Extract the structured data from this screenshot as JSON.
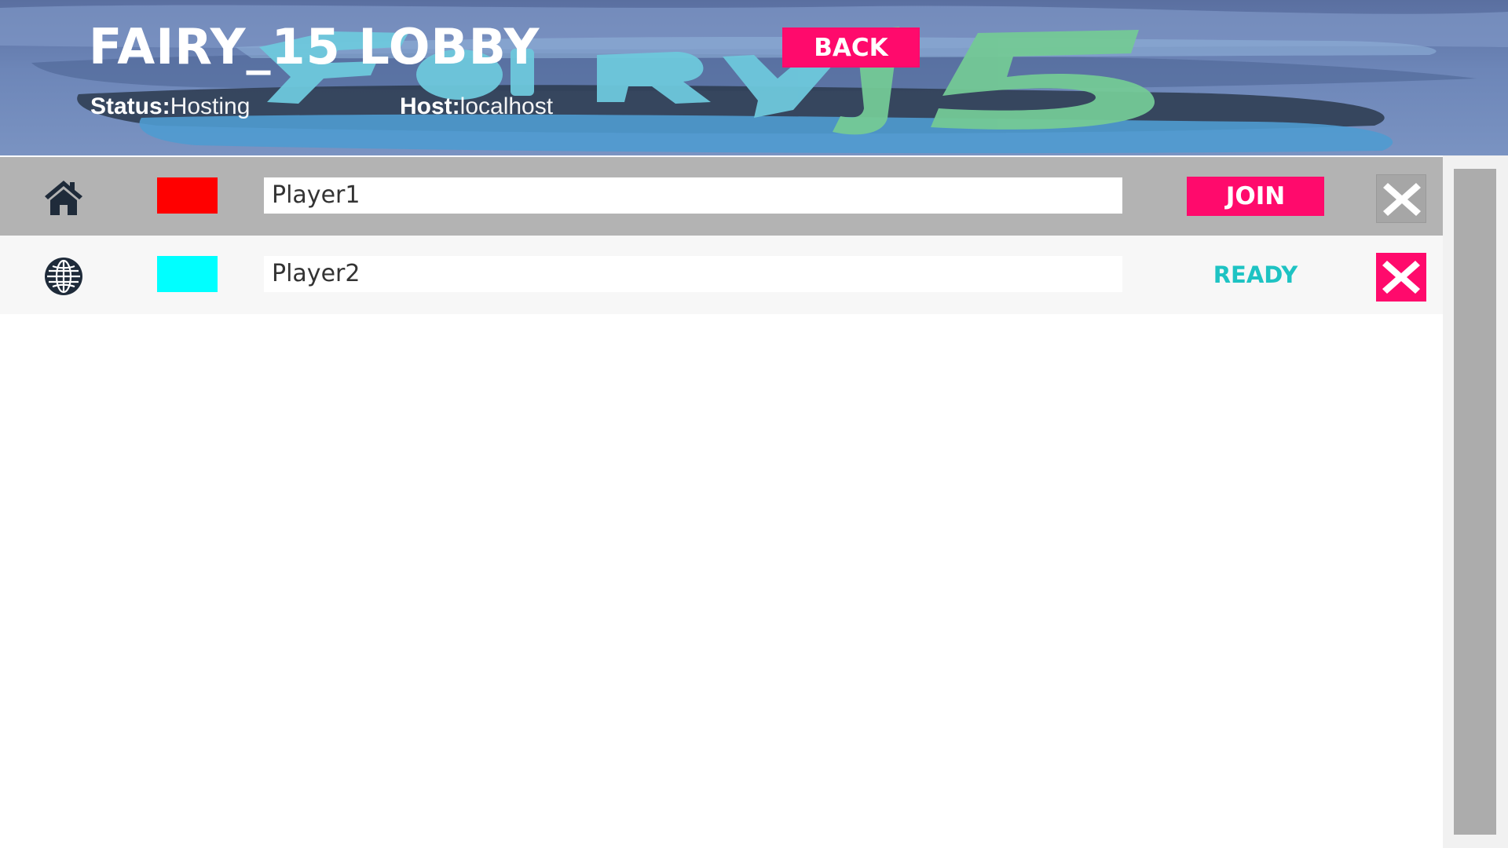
{
  "header": {
    "title": "FAIRY_15 LOBBY",
    "back_label": "BACK",
    "status_label": "Status:",
    "status_value": "Hosting",
    "host_label": "Host:",
    "host_value": "localhost",
    "logo_text": "Fairy 15"
  },
  "players": [
    {
      "type_icon": "home-icon",
      "color": "#ff0000",
      "name": "Player1",
      "action_label": "JOIN",
      "remove_icon": "close-icon"
    },
    {
      "type_icon": "globe-icon",
      "color": "#00ffff",
      "name": "Player2",
      "status_label": "READY",
      "remove_icon": "close-icon"
    }
  ],
  "colors": {
    "accent": "#ff0a6c",
    "ready": "#1ec3c3",
    "local_row": "#b3b3b3",
    "remote_row": "#f7f7f7"
  }
}
